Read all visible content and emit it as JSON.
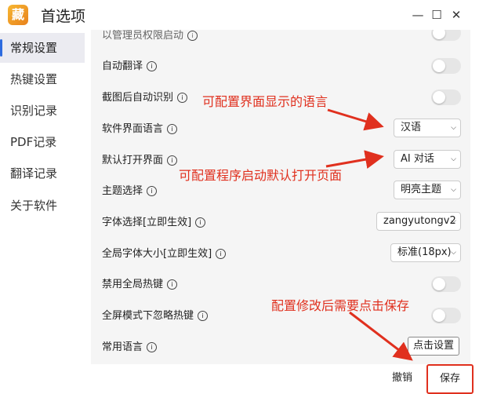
{
  "window": {
    "title": "首选项",
    "app_icon_char": "藏",
    "minimize": "—",
    "maximize": "☐",
    "close": "✕"
  },
  "sidebar": {
    "items": [
      {
        "label": "常规设置",
        "active": true
      },
      {
        "label": "热键设置",
        "active": false
      },
      {
        "label": "识别记录",
        "active": false
      },
      {
        "label": "PDF记录",
        "active": false
      },
      {
        "label": "翻译记录",
        "active": false
      },
      {
        "label": "关于软件",
        "active": false
      }
    ]
  },
  "settings": {
    "partial_top_label": "以管理员权限启动",
    "auto_translate": {
      "label": "自动翻译",
      "enabled": false
    },
    "auto_ocr_after_screenshot": {
      "label": "截图后自动识别",
      "enabled": false
    },
    "ui_language": {
      "label": "软件界面语言",
      "value": "汉语"
    },
    "default_open_page": {
      "label": "默认打开界面",
      "value": "AI 对话"
    },
    "theme": {
      "label": "主题选择",
      "value": "明亮主题"
    },
    "font": {
      "label": "字体选择[立即生效]",
      "value": "zangyutongv2"
    },
    "global_font_size": {
      "label": "全局字体大小[立即生效]",
      "value": "标准(18px)"
    },
    "disable_global_hotkeys": {
      "label": "禁用全局热键",
      "enabled": false
    },
    "ignore_hotkeys_fullscreen": {
      "label": "全屏模式下忽略热键",
      "enabled": false
    },
    "common_languages": {
      "label": "常用语言",
      "button": "点击设置"
    }
  },
  "footer": {
    "cancel": "撤销",
    "save": "保存"
  },
  "annotations": {
    "ui_language_note": "可配置界面显示的语言",
    "default_page_note": "可配置程序启动默认打开页面",
    "save_note": "配置修改后需要点击保存",
    "color": "#e0301e"
  },
  "colors": {
    "accent": "#2d6bdf",
    "content_bg": "#f5f5f5",
    "annotation": "#e0301e"
  }
}
